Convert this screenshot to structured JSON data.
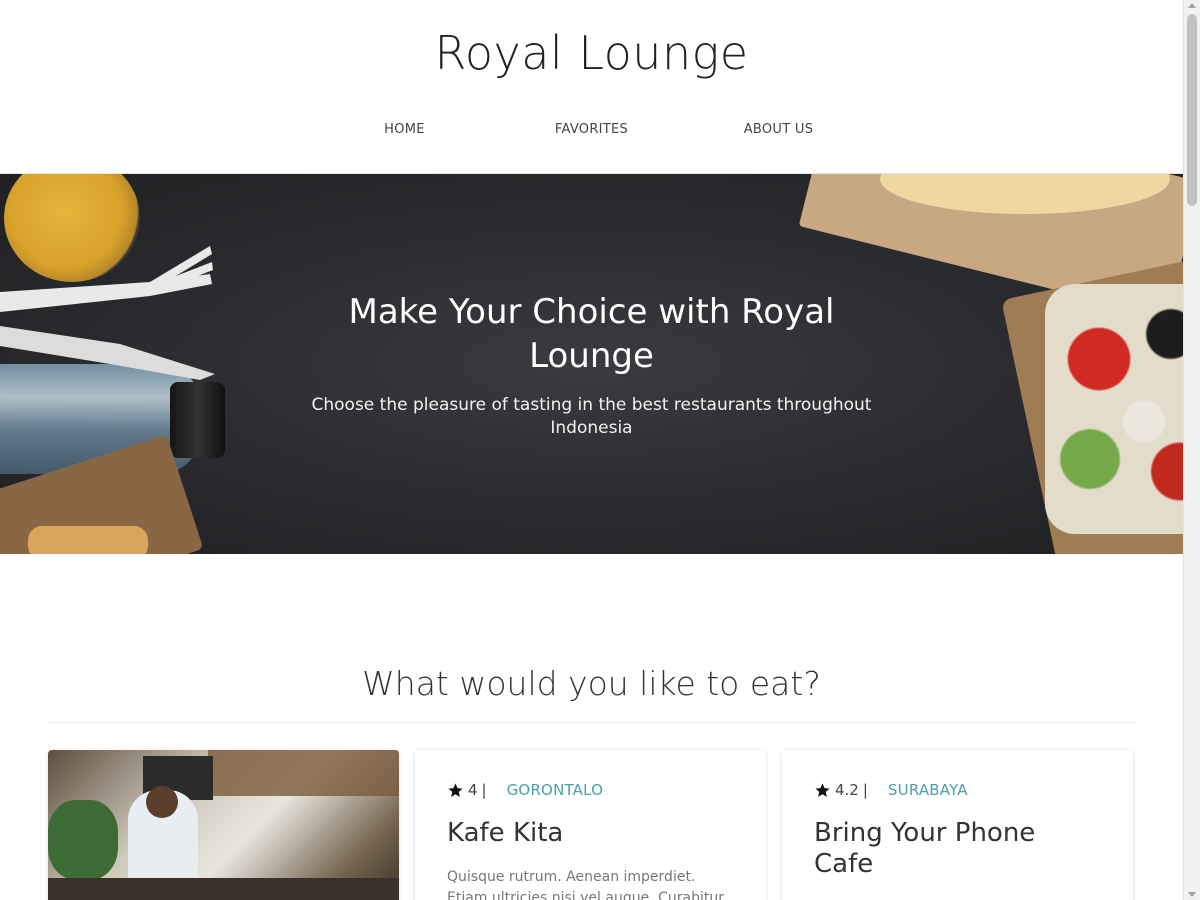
{
  "header": {
    "brand": "Royal Lounge",
    "nav": [
      "HOME",
      "FAVORITES",
      "ABOUT US"
    ]
  },
  "hero": {
    "title": "Make Your Choice with Royal Lounge",
    "subtitle": "Choose the pleasure of tasting in the best restaurants throughout Indonesia"
  },
  "section": {
    "title": "What would you like to eat?"
  },
  "cards": [
    {
      "rating": "4",
      "separator": "|",
      "city": "GORONTALO",
      "name": "Kafe Kita",
      "description": "Quisque rutrum. Aenean imperdiet. Etiam ultricies nisi vel augue. Curabitur"
    },
    {
      "rating": "4.2",
      "separator": "|",
      "city": "SURABAYA",
      "name": "Bring Your Phone Cafe",
      "description": ""
    }
  ],
  "colors": {
    "accent": "#4aa0ac",
    "hero_bg": "#2c2d30",
    "text": "#333333"
  },
  "icons": {
    "rating": "star-icon"
  }
}
